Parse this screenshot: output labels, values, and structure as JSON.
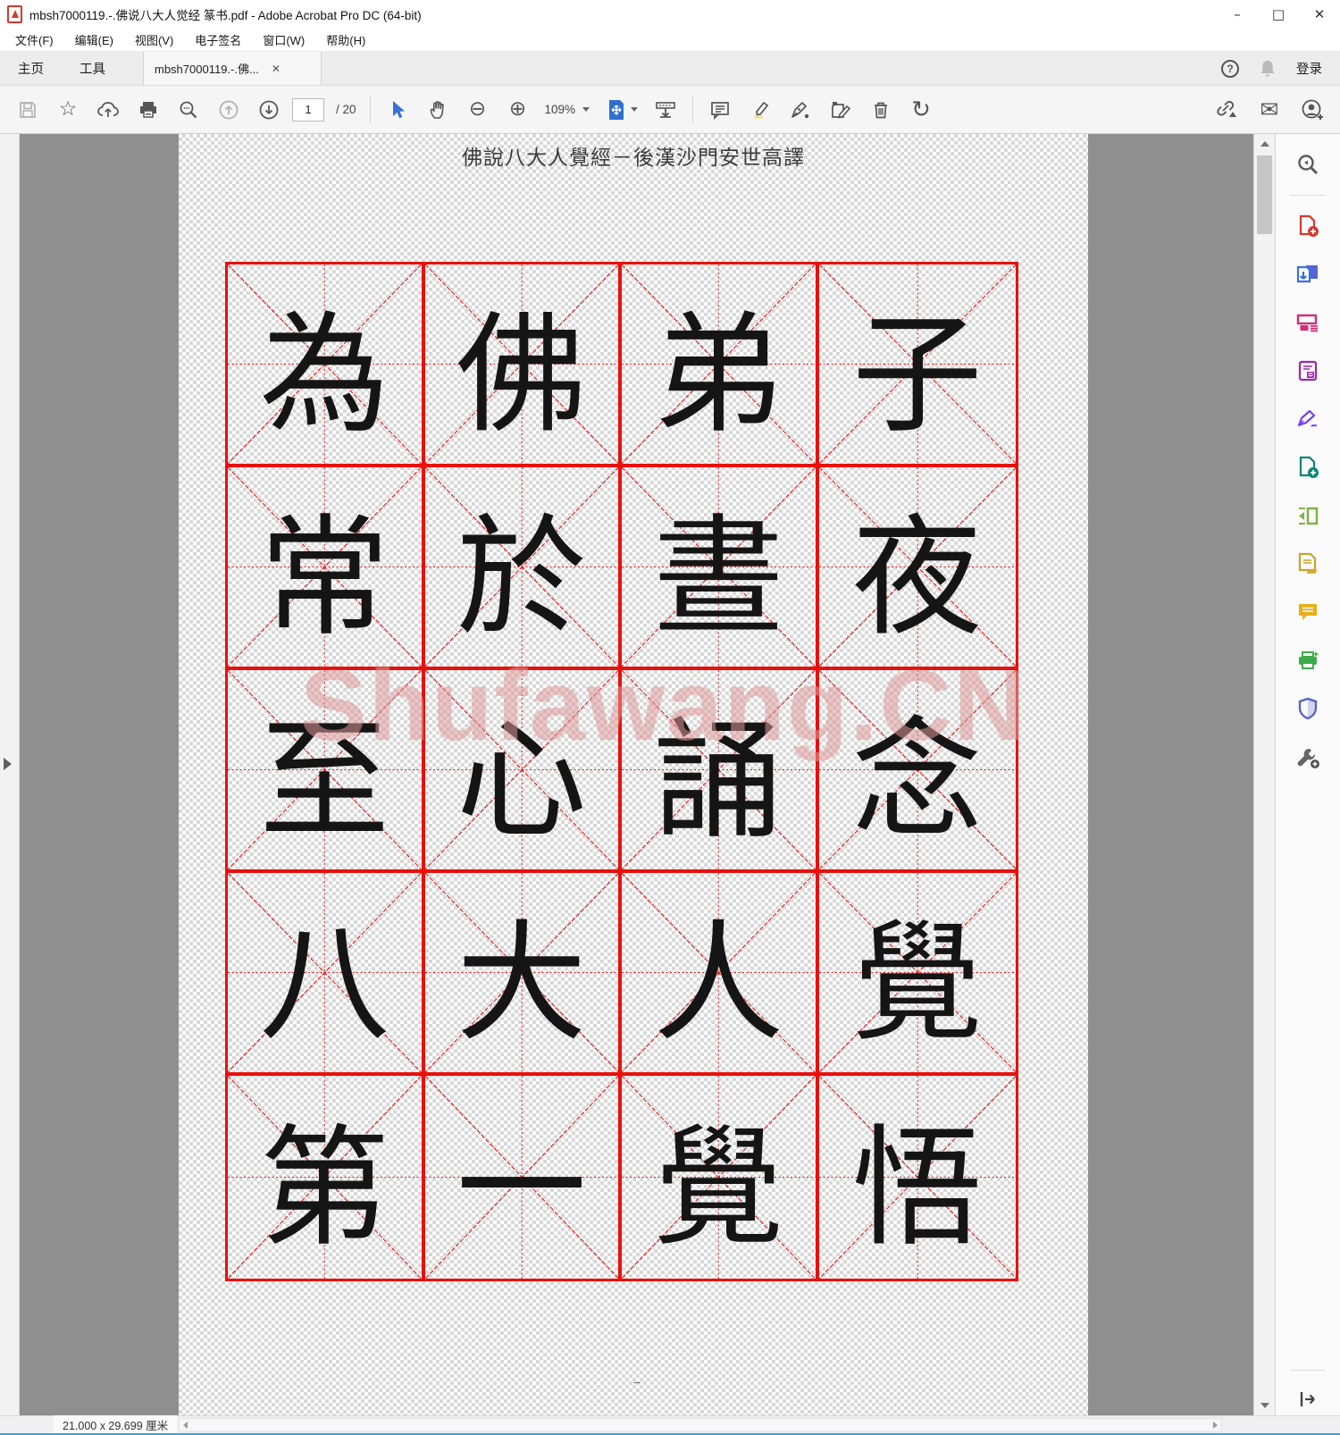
{
  "window": {
    "title": "mbsh7000119.-.佛说八大人觉经 篆书.pdf - Adobe Acrobat Pro DC (64-bit)",
    "minimize_glyph": "–",
    "maximize_glyph": "□",
    "close_glyph": "✕"
  },
  "menu": {
    "items": [
      "文件(F)",
      "编辑(E)",
      "视图(V)",
      "电子签名",
      "窗口(W)",
      "帮助(H)"
    ]
  },
  "tabs": {
    "home": "主页",
    "tools": "工具",
    "document": "mbsh7000119.-.佛...",
    "document_close_glyph": "✕",
    "help_glyph": "?",
    "signin": "登录"
  },
  "toolbar": {
    "page_current": "1",
    "page_total": "/ 20",
    "zoom_level": "109%",
    "icons": [
      "save",
      "favorite-star",
      "share-cloud",
      "print",
      "search",
      "previous-page",
      "next-page",
      "select-tool",
      "hand-tool",
      "zoom-out",
      "zoom-in",
      "fit-page",
      "fit-width",
      "comment",
      "highlight",
      "sign",
      "stamp-edit",
      "delete",
      "redo",
      "share-link",
      "email",
      "account"
    ]
  },
  "page": {
    "title": "佛說八大人覺經－後漢沙門安世高譯",
    "watermark": "Shufawang.CN",
    "footer_mark": "–",
    "grid": {
      "rows": [
        [
          "為",
          "佛",
          "弟",
          "子"
        ],
        [
          "常",
          "於",
          "晝",
          "夜"
        ],
        [
          "至",
          "心",
          "誦",
          "念"
        ],
        [
          "八",
          "大",
          "人",
          "覺"
        ],
        [
          "第",
          "一",
          "覺",
          "悟"
        ]
      ]
    }
  },
  "sidebar": {
    "tools": [
      "search",
      "create-pdf",
      "export-pdf",
      "organize-pages",
      "compress-pdf",
      "fill-and-sign",
      "convert-pdf",
      "edit-pdf",
      "request-signatures",
      "comment",
      "scan-ocr",
      "protect",
      "more-tools"
    ]
  },
  "statusbar": {
    "dimensions": "21.000 x 29.699 厘米"
  },
  "colors": {
    "grid_red": "#e8100c",
    "watermark_pink": "#dd9999",
    "accent_blue": "#2a6fd3",
    "doc_background_gray": "#8f8f8f"
  }
}
